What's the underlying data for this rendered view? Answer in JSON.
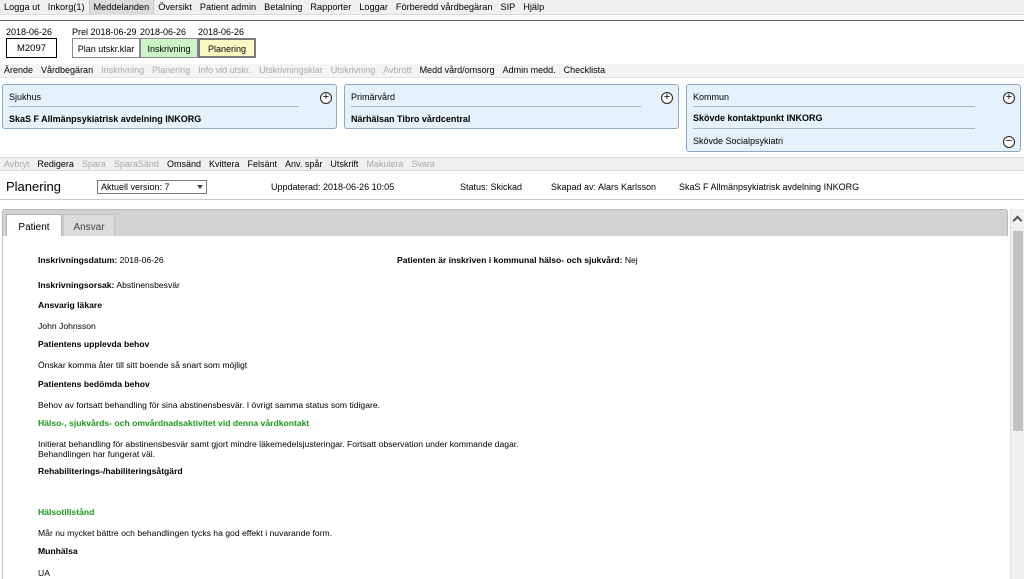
{
  "menu": [
    "Logga ut",
    "Inkorg(1)",
    "Meddelanden",
    "Översikt",
    "Patient admin",
    "Betalning",
    "Rapporter",
    "Loggar",
    "Förberedd vårdbegäran",
    "SIP",
    "Hjälp"
  ],
  "patient": {
    "date": "2018-06-26",
    "id": "M2097"
  },
  "process": {
    "step1_date": "Prel 2018-06-29",
    "step1_label": "Plan utskr.klar",
    "step2_date": "2018-06-26",
    "step2_label": "Inskrivning",
    "step3_date": "2018-06-26",
    "step3_label": "Planering"
  },
  "toolbar1": [
    {
      "label": "Ärende",
      "enabled": true
    },
    {
      "label": "Vårdbegäran",
      "enabled": true
    },
    {
      "label": "Inskrivning",
      "enabled": false
    },
    {
      "label": "Planering",
      "enabled": false
    },
    {
      "label": "Info vid utskr.",
      "enabled": false
    },
    {
      "label": "Utskrivningsklar",
      "enabled": false
    },
    {
      "label": "Utskrivning",
      "enabled": false
    },
    {
      "label": "Avbrott",
      "enabled": false
    },
    {
      "label": "Medd vård/omsorg",
      "enabled": true
    },
    {
      "label": "Admin medd.",
      "enabled": true
    },
    {
      "label": "Checklista",
      "enabled": true
    }
  ],
  "panels": {
    "sjukhus": {
      "title": "Sjukhus",
      "value": "SkaS F Allmänpsykiatrisk avdelning INKORG"
    },
    "primarvard": {
      "title": "Primärvård",
      "value": "Närhälsan Tibro vårdcentral"
    },
    "kommun": {
      "title": "Kommun",
      "value1": "Skövde kontaktpunkt INKORG",
      "value2": "Skövde Socialpsykiatri"
    }
  },
  "toolbar2": [
    {
      "label": "Avbryt",
      "enabled": false
    },
    {
      "label": "Redigera",
      "enabled": true
    },
    {
      "label": "Spara",
      "enabled": false
    },
    {
      "label": "SparaSänd",
      "enabled": false
    },
    {
      "label": "Omsänd",
      "enabled": true
    },
    {
      "label": "Kvittera",
      "enabled": true
    },
    {
      "label": "Felsänt",
      "enabled": true
    },
    {
      "label": "Anv. spår",
      "enabled": true
    },
    {
      "label": "Utskrift",
      "enabled": true
    },
    {
      "label": "Makulera",
      "enabled": false
    },
    {
      "label": "Svara",
      "enabled": false
    }
  ],
  "info": {
    "title": "Planering",
    "version": "Aktuell version: 7",
    "updated": "Uppdaterad: 2018-06-26 10:05",
    "status": "Status: Skickad",
    "created_by": "Skapad av: Alars Karlsson",
    "unit": "SkaS F Allmänpsykiatrisk avdelning INKORG"
  },
  "tabs": [
    "Patient",
    "Ansvar"
  ],
  "content": {
    "inskrivningsdatum_label": "Inskrivningsdatum:",
    "inskrivningsdatum": "2018-06-26",
    "kommunal_label": "Patienten är inskriven i kommunal hälso- och sjukvård:",
    "kommunal": "Nej",
    "orsak_label": "Inskrivningsorsak:",
    "orsak": "Abstinensbesvär",
    "ansvarig_heading": "Ansvarig läkare",
    "ansvarig": "John Johnsson",
    "upplevda_heading": "Patientens upplevda behov",
    "upplevda": "Önskar komma åter till sitt boende så snart som möjligt",
    "bedomda_heading": "Patientens bedömda behov",
    "bedomda": "Behov av fortsatt behandling för sina abstinensbesvär. I övrigt samma status som tidigare.",
    "aktivitet_heading": "Hälso-, sjukvårds- och omvårdnadsaktivitet vid denna vårdkontakt",
    "aktivitet_line1": "Initierat behandling för abstinensbesvär samt gjort mindre läkemedelsjusteringar. Fortsatt observation under kommande dagar.",
    "aktivitet_line2": "Behandlingen har fungerat väl.",
    "rehab_heading": "Rehabiliterings-/habiliteringsåtgärd",
    "halsotillstand_heading": "Hälsotillstånd",
    "halsotillstand": "Mår nu mycket bättre och behandlingen tycks ha god effekt i nuvarande form.",
    "munhalsa_heading": "Munhälsa",
    "munhalsa": "UA"
  },
  "colors": {
    "green_heading": "#1a9a1a",
    "panel_bg": "#e5f1fb",
    "inskrivning_bg": "#ccf2c8",
    "planering_bg": "#fbf8c3"
  }
}
